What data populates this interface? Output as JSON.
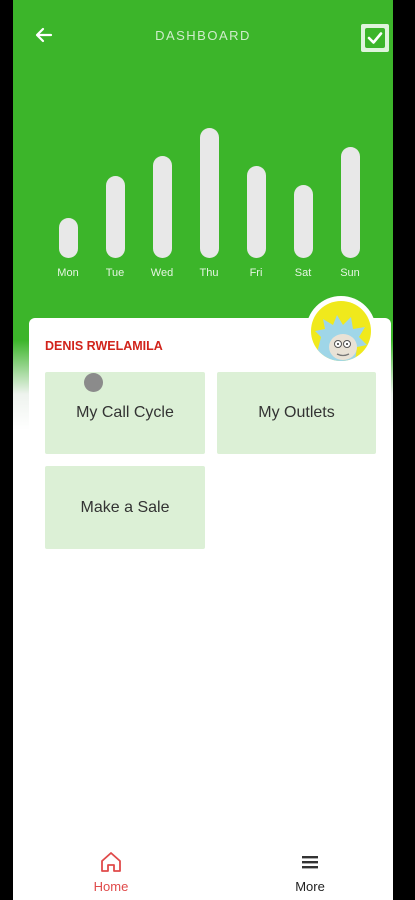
{
  "header": {
    "title": "DASHBOARD",
    "back_icon": "arrow-left-icon",
    "action_icon": "checkbox-checked-icon"
  },
  "chart_data": {
    "type": "bar",
    "categories": [
      "Mon",
      "Tue",
      "Wed",
      "Thu",
      "Fri",
      "Sat",
      "Sun"
    ],
    "values": [
      40,
      82,
      102,
      130,
      92,
      73,
      111
    ],
    "ylim": [
      0,
      130
    ],
    "grid": false,
    "bar_color": "#e8e8e8"
  },
  "user": {
    "name": "DENIS RWELAMILA",
    "avatar_icon": "avatar"
  },
  "tiles": [
    {
      "label": "My Call Cycle"
    },
    {
      "label": "My Outlets"
    },
    {
      "label": "Make a Sale"
    }
  ],
  "nav": {
    "home": {
      "label": "Home",
      "icon": "home-icon"
    },
    "more": {
      "label": "More",
      "icon": "menu-icon"
    }
  },
  "colors": {
    "brand_green": "#3cb52a",
    "accent_red": "#d1231b",
    "tile_bg": "#dcf0d6"
  }
}
